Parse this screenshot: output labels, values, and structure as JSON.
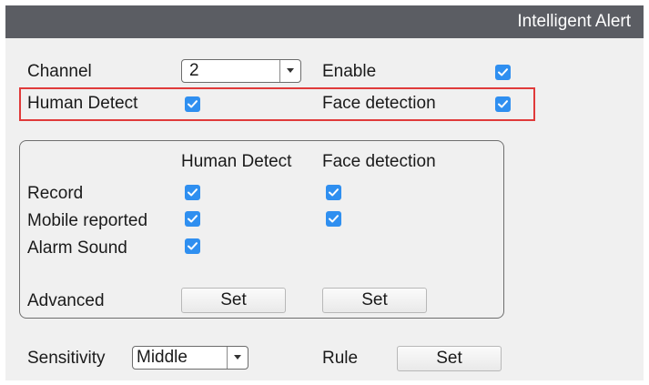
{
  "window": {
    "title": "Intelligent Alert"
  },
  "top": {
    "channel_label": "Channel",
    "channel_value": "2",
    "enable_label": "Enable",
    "human_detect_label": "Human Detect",
    "face_detection_label": "Face detection"
  },
  "group": {
    "col_human": "Human Detect",
    "col_face": "Face detection",
    "rows": {
      "record": "Record",
      "mobile": "Mobile reported",
      "alarm": "Alarm Sound",
      "advanced": "Advanced"
    },
    "set_label": "Set"
  },
  "bottom": {
    "sensitivity_label": "Sensitivity",
    "sensitivity_value": "Middle",
    "rule_label": "Rule",
    "set_label": "Set"
  },
  "colors": {
    "checkbox": "#2f8ff0",
    "titlebar": "#5b5d63",
    "highlight": "#e03a3a"
  },
  "icons": {
    "checkbox": "checkmark-icon",
    "dropdown": "chevron-down-icon"
  }
}
